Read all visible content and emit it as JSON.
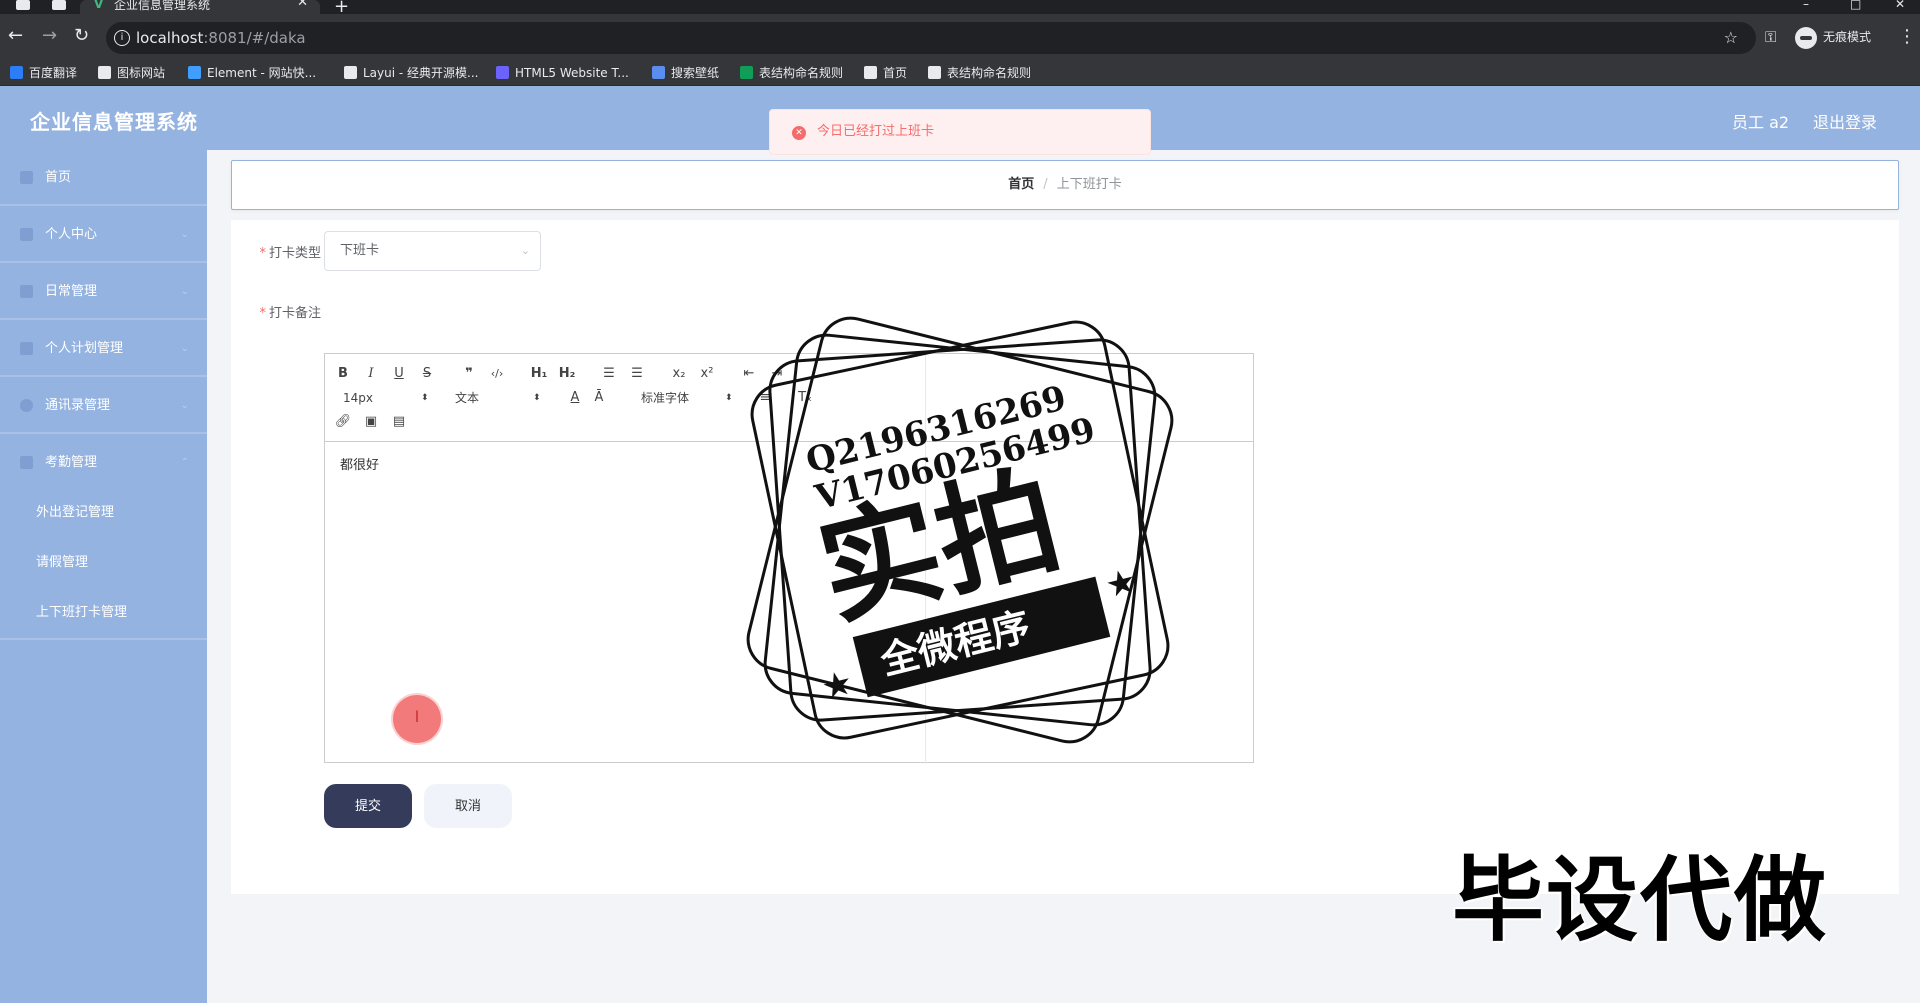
{
  "browser": {
    "tab_title": "企业信息管理系统",
    "tab_close": "✕",
    "new_tab": "+",
    "url_host": "localhost",
    "url_path": ":8081/#/daka",
    "incognito_label": "无痕模式",
    "bookmarks": [
      {
        "label": "百度翻译",
        "color": "#2d7df6"
      },
      {
        "label": "图标网站",
        "color": "#e8eaed"
      },
      {
        "label": "Element - 网站快...",
        "color": "#409eff"
      },
      {
        "label": "Layui - 经典开源模...",
        "color": "#e8eaed"
      },
      {
        "label": "HTML5 Website T...",
        "color": "#6c63ff"
      },
      {
        "label": "搜索壁纸",
        "color": "#5b8def"
      },
      {
        "label": "表结构命名规则",
        "color": "#0f9d58"
      },
      {
        "label": "首页",
        "color": "#e8eaed"
      },
      {
        "label": "表结构命名规则",
        "color": "#e8eaed"
      }
    ]
  },
  "header": {
    "app_title": "企业信息管理系统",
    "user": "员工 a2",
    "logout": "退出登录"
  },
  "sidebar": {
    "items": [
      {
        "label": "首页",
        "icon": "home-icon",
        "has_arrow": false
      },
      {
        "label": "个人中心",
        "icon": "user-icon",
        "has_arrow": true
      },
      {
        "label": "日常管理",
        "icon": "calendar-icon",
        "has_arrow": true
      },
      {
        "label": "个人计划管理",
        "icon": "plan-icon",
        "has_arrow": true
      },
      {
        "label": "通讯录管理",
        "icon": "contacts-icon",
        "has_arrow": true
      },
      {
        "label": "考勤管理",
        "icon": "grid-icon",
        "has_arrow": true,
        "expanded": true
      }
    ],
    "subitems": [
      {
        "label": "外出登记管理"
      },
      {
        "label": "请假管理"
      },
      {
        "label": "上下班打卡管理"
      }
    ]
  },
  "breadcrumb": {
    "home": "首页",
    "separator": "/",
    "current": "上下班打卡"
  },
  "form": {
    "type_label": "打卡类型",
    "type_value": "下班卡",
    "note_label": "打卡备注",
    "note_value": "都很好",
    "submit": "提交",
    "cancel": "取消"
  },
  "editor": {
    "font_size": "14px",
    "block_format": "文本",
    "font_family": "标准字体"
  },
  "toast": {
    "message": "今日已经打过上班卡",
    "type": "error",
    "color": "#f56c6c"
  },
  "watermark": {
    "qq": "Q2196316269",
    "wx": "V17060256499",
    "main": "实拍",
    "ribbon": "全微程序",
    "corner": "毕设代做"
  },
  "colors": {
    "theme": "#95b3e0",
    "submit_button": "#353b5a"
  }
}
